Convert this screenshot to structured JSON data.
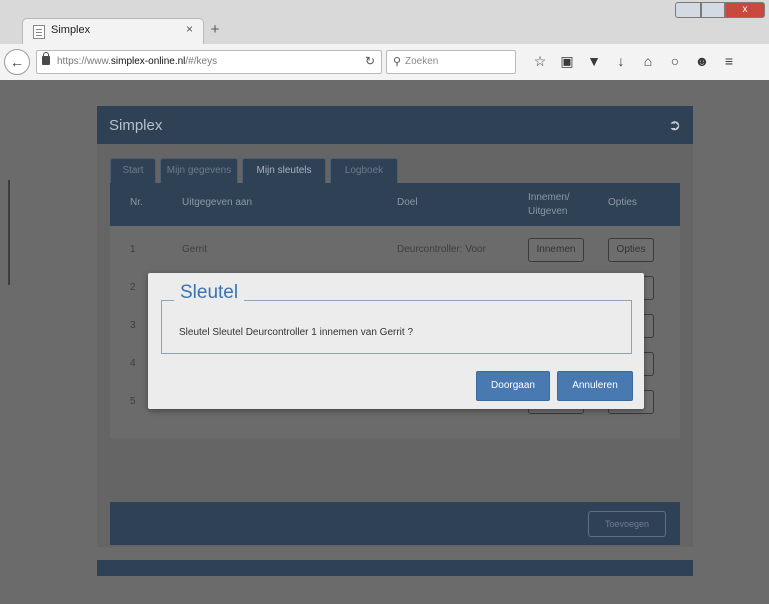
{
  "browser": {
    "tab_title": "Simplex",
    "tab_close": "×",
    "new_tab": "+",
    "url_prefix": "https://www.",
    "url_domain": "simplex-online.nl",
    "url_path": "/#/keys",
    "search_placeholder": "Zoeken",
    "toolbar_icons": [
      "star-icon",
      "reading-list-icon",
      "pocket-icon",
      "download-icon",
      "home-icon",
      "chat-icon",
      "avatar-icon",
      "menu-icon"
    ],
    "window_close": "x"
  },
  "app": {
    "title": "Simplex",
    "tabs": [
      "Start",
      "Mijn gegevens",
      "Mijn sleutels",
      "Logboek"
    ],
    "active_tab": 2,
    "table": {
      "headers": {
        "nr": "Nr.",
        "given_to": "Uitgegeven aan",
        "item": "Doel",
        "inout": "Innemen/ Uitgeven",
        "options": "Opties"
      },
      "rows": [
        {
          "nr": "1",
          "given_to": "Gerrit",
          "item": "Deurcontroller: Voor",
          "action": "Innemen",
          "options": "Opties"
        },
        {
          "nr": "2"
        },
        {
          "nr": "3"
        },
        {
          "nr": "4"
        },
        {
          "nr": "5"
        }
      ]
    },
    "footer_button": "Toevoegen"
  },
  "modal": {
    "title": "Sleutel",
    "message": "Sleutel Sleutel Deurcontroller 1 innemen van Gerrit ?",
    "confirm_label": "Doorgaan",
    "cancel_label": "Annuleren"
  },
  "colors": {
    "header_bg": "#2f4154",
    "primary_button": "#4879b1",
    "modal_title": "#3b73ad"
  }
}
